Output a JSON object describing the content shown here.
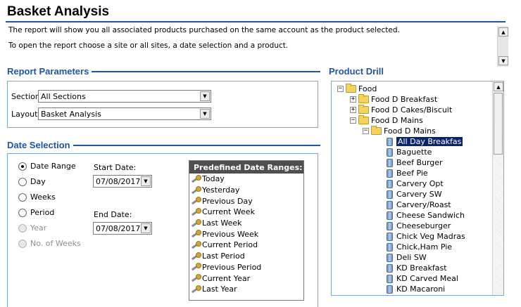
{
  "header": {
    "title": "Basket Analysis",
    "desc_line1": "The report will show you all associated products purchased on the same account as the product selected.",
    "desc_line2": "To open the report choose a site or all sites, a date selection and a product."
  },
  "report_parameters": {
    "heading": "Report Parameters",
    "section_label": "Section:",
    "section_value": "All Sections",
    "layout_label": "Layout:",
    "layout_value": "Basket Analysis"
  },
  "date_selection": {
    "heading": "Date Selection",
    "options": [
      "Date Range",
      "Day",
      "Weeks",
      "Period",
      "Year",
      "No. of Weeks"
    ],
    "selected": "Date Range",
    "start_label": "Start Date:",
    "start_value": "07/08/2017",
    "end_label": "End Date:",
    "end_value": "07/08/2017"
  },
  "predefined": {
    "heading": "Predefined Date Ranges:",
    "items": [
      "Today",
      "Yesterday",
      "Previous Day",
      "Current Week",
      "Last Week",
      "Previous Week",
      "Current Period",
      "Last Period",
      "Previous Period",
      "Current Year",
      "Last Year"
    ]
  },
  "product_drill": {
    "heading": "Product Drill",
    "root": "Food",
    "level1": [
      "Food D Breakfast",
      "Food D Cakes/Biscuit",
      "Food D Mains"
    ],
    "level2": "Food D Mains",
    "products": [
      "All Day Breakfas",
      "Baguette",
      "Beef Burger",
      "Beef Pie",
      "Carvery Opt",
      "Carvery SW",
      "Carvery/Roast",
      "Cheese Sandwich",
      "Cheeseburger",
      "Chick Veg Madras",
      "Chick,Ham Pie",
      "Deli SW",
      "KD Breakfast",
      "KD Carved Meal",
      "KD Macaroni"
    ],
    "selected": "All Day Breakfas"
  },
  "colors": {
    "accent": "#1e56a0",
    "selection": "#0a246a"
  }
}
